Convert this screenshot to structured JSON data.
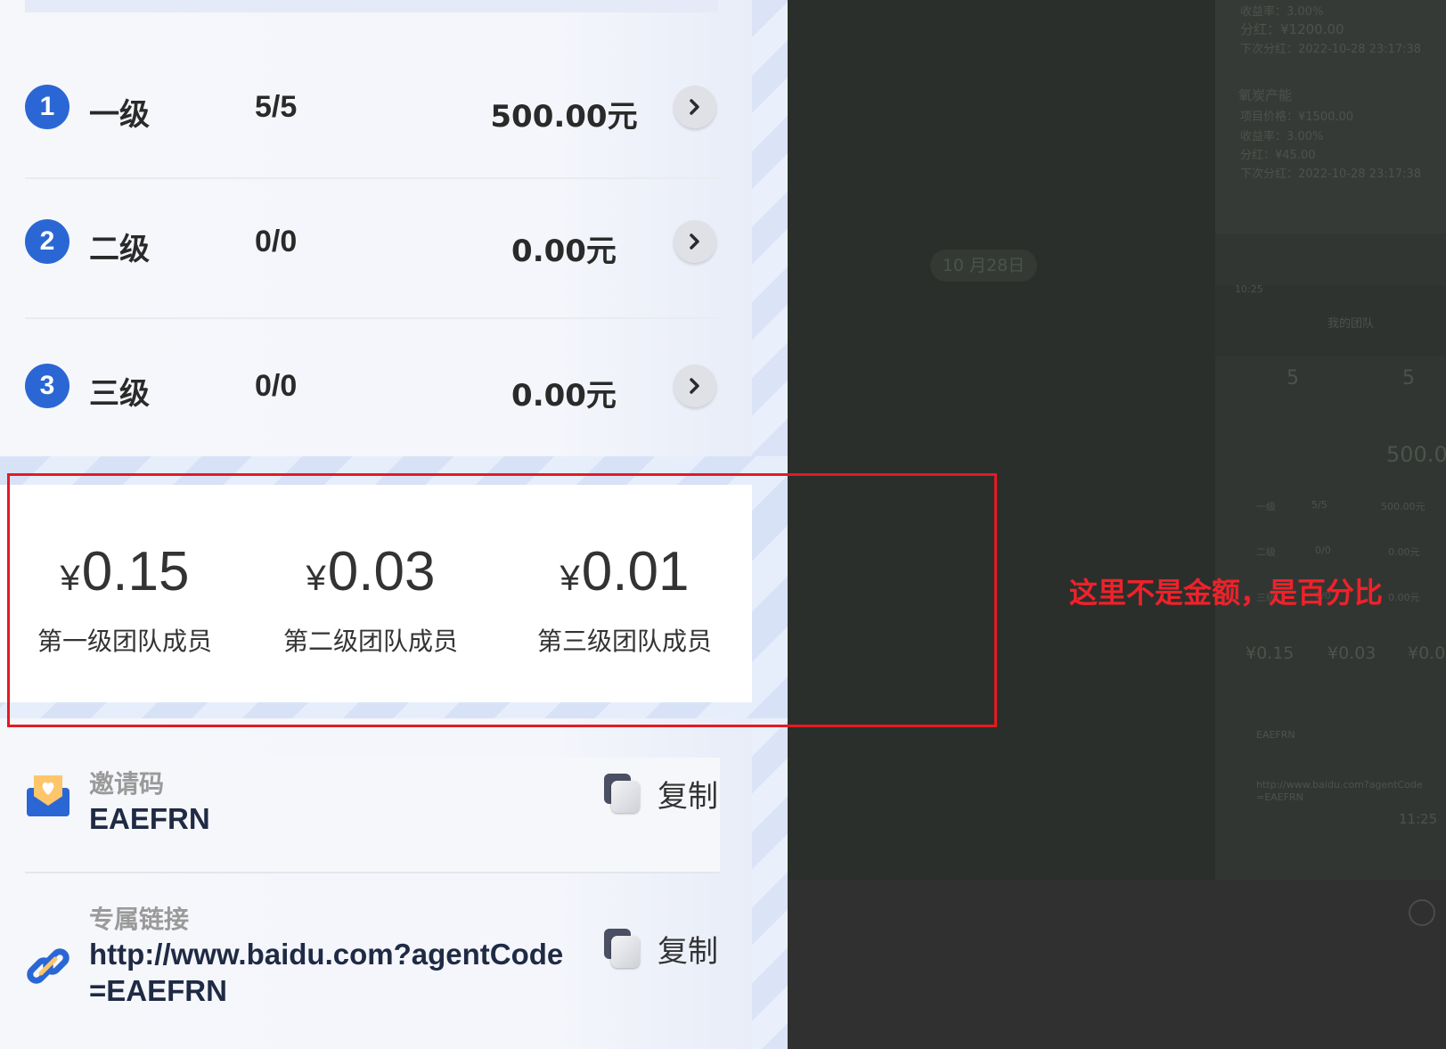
{
  "team_levels": [
    {
      "num": "1",
      "name": "一级",
      "count": "5/5",
      "amount": "500.00元"
    },
    {
      "num": "2",
      "name": "二级",
      "count": "0/0",
      "amount": "0.00元"
    },
    {
      "num": "3",
      "name": "三级",
      "count": "0/0",
      "amount": "0.00元"
    }
  ],
  "commission": [
    {
      "currency": "¥",
      "value": "0.15",
      "label": "第一级团队成员"
    },
    {
      "currency": "¥",
      "value": "0.03",
      "label": "第二级团队成员"
    },
    {
      "currency": "¥",
      "value": "0.01",
      "label": "第三级团队成员"
    }
  ],
  "invite": {
    "title": "邀请码",
    "code": "EAEFRN",
    "copy_label": "复制",
    "icon": "envelope-heart-icon"
  },
  "link": {
    "title": "专属链接",
    "url_line1": "http://www.baidu.com?agentCode",
    "url_line2": "=EAEFRN",
    "copy_label": "复制",
    "icon": "link-icon"
  },
  "annotation": {
    "text": "这里不是金额，是百分比",
    "color": "#e31b23"
  },
  "background_chat": {
    "date_pill": "10 月28日",
    "mini_screen": {
      "top_lines": [
        "收益率：3.00%",
        "分红：¥1200.00",
        "下次分红：2022-10-28 23:17:38"
      ],
      "product_name": "氧炭产能",
      "product_lines": [
        "项目价格：¥1500.00",
        "收益率：3.00%",
        "分红：¥45.00",
        "下次分红：2022-10-28 23:17:38"
      ],
      "status_time": "10:25",
      "page_title": "我的团队",
      "stat_a": "5",
      "stat_b": "5",
      "total": "500.0",
      "rows": [
        {
          "name": "一级",
          "count": "5/5",
          "amount": "500.00元"
        },
        {
          "name": "二级",
          "count": "0/0",
          "amount": "0.00元"
        },
        {
          "name": "三级",
          "count": "0/0",
          "amount": "0.00元"
        }
      ],
      "pcts": [
        "¥0.15",
        "¥0.03",
        "¥0.0"
      ],
      "invite_code": "EAEFRN",
      "link_line1": "http://www.baidu.com?agentCode",
      "link_line2": "=EAEFRN",
      "msg_time": "11:25"
    }
  }
}
